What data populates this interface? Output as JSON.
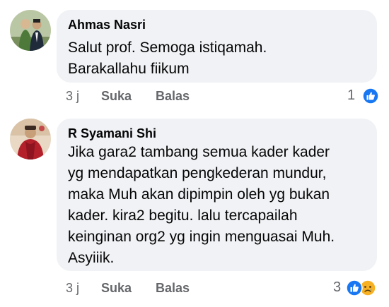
{
  "comments": [
    {
      "author": "Ahmas Nasri",
      "lines": [
        "Salut prof. Semoga istiqamah.",
        "Barakallahu fiikum"
      ],
      "time": "3 j",
      "like_label": "Suka",
      "reply_label": "Balas",
      "reaction_count": "1",
      "reaction_icons": [
        "like-icon"
      ]
    },
    {
      "author": "R Syamani Shi",
      "lines": [
        "Jika gara2 tambang semua kader kader",
        "yg mendapatkan pengkederan mundur,",
        "maka Muh akan dipimpin oleh yg bukan",
        "kader. kira2 begitu. lalu tercapailah",
        "keinginan org2 yg ingin menguasai Muh.",
        "Asyiiik."
      ],
      "time": "3 j",
      "like_label": "Suka",
      "reply_label": "Balas",
      "reaction_count": "3",
      "reaction_icons": [
        "like-icon",
        "sad-icon"
      ]
    }
  ],
  "colors": {
    "bubble": "#f0f2f5",
    "secondary_text": "#65676b",
    "like_blue": "#1877f2",
    "sad_yellow": "#f7b125"
  }
}
